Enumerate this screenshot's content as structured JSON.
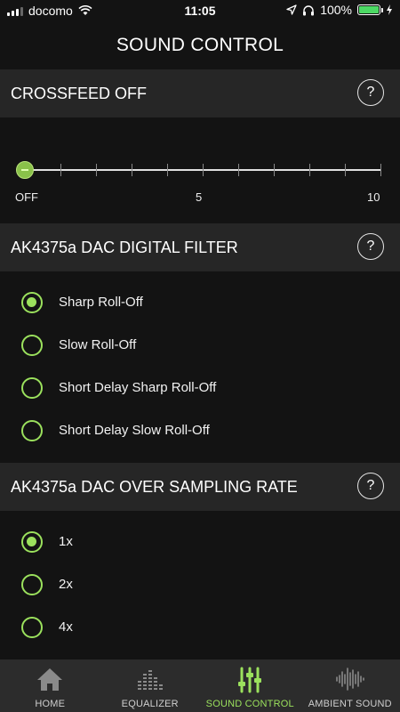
{
  "status": {
    "carrier": "docomo",
    "time": "11:05",
    "battery": "100%"
  },
  "header": {
    "title": "SOUND CONTROL"
  },
  "crossfeed": {
    "title": "CROSSFEED OFF",
    "help": "?",
    "scale": {
      "min": "OFF",
      "mid": "5",
      "max": "10"
    },
    "value": 0
  },
  "digital_filter": {
    "title": "AK4375a DAC DIGITAL FILTER",
    "help": "?",
    "options": [
      {
        "label": "Sharp Roll-Off",
        "selected": true
      },
      {
        "label": "Slow Roll-Off",
        "selected": false
      },
      {
        "label": "Short Delay Sharp Roll-Off",
        "selected": false
      },
      {
        "label": "Short Delay Slow Roll-Off",
        "selected": false
      }
    ]
  },
  "oversampling": {
    "title": "AK4375a DAC OVER SAMPLING RATE",
    "help": "?",
    "options": [
      {
        "label": "1x",
        "selected": true
      },
      {
        "label": "2x",
        "selected": false
      },
      {
        "label": "4x",
        "selected": false
      }
    ]
  },
  "tabs": [
    {
      "label": "HOME",
      "icon": "home-icon",
      "active": false
    },
    {
      "label": "EQUALIZER",
      "icon": "equalizer-icon",
      "active": false
    },
    {
      "label": "SOUND CONTROL",
      "icon": "sliders-icon",
      "active": true
    },
    {
      "label": "AMBIENT SOUND",
      "icon": "waveform-icon",
      "active": false
    }
  ],
  "colors": {
    "accent": "#9be15d",
    "background": "#131313",
    "section": "#262626",
    "tabbar": "#2c2c2c"
  }
}
